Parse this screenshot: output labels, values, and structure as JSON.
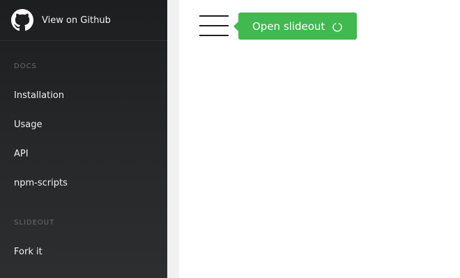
{
  "sidebar": {
    "github": {
      "label": "View on Github",
      "icon": "github-icon"
    },
    "sections": [
      {
        "title": "DOCS",
        "items": [
          {
            "label": "Installation"
          },
          {
            "label": "Usage"
          },
          {
            "label": "API"
          },
          {
            "label": "npm-scripts"
          }
        ]
      },
      {
        "title": "SLIDEOUT",
        "items": [
          {
            "label": "Fork it"
          }
        ]
      }
    ]
  },
  "main": {
    "menu_toggle": {
      "icon": "hamburger-icon"
    },
    "open_button": {
      "label": "Open slideout",
      "icon": "smile-icon",
      "color": "#42b850"
    }
  }
}
